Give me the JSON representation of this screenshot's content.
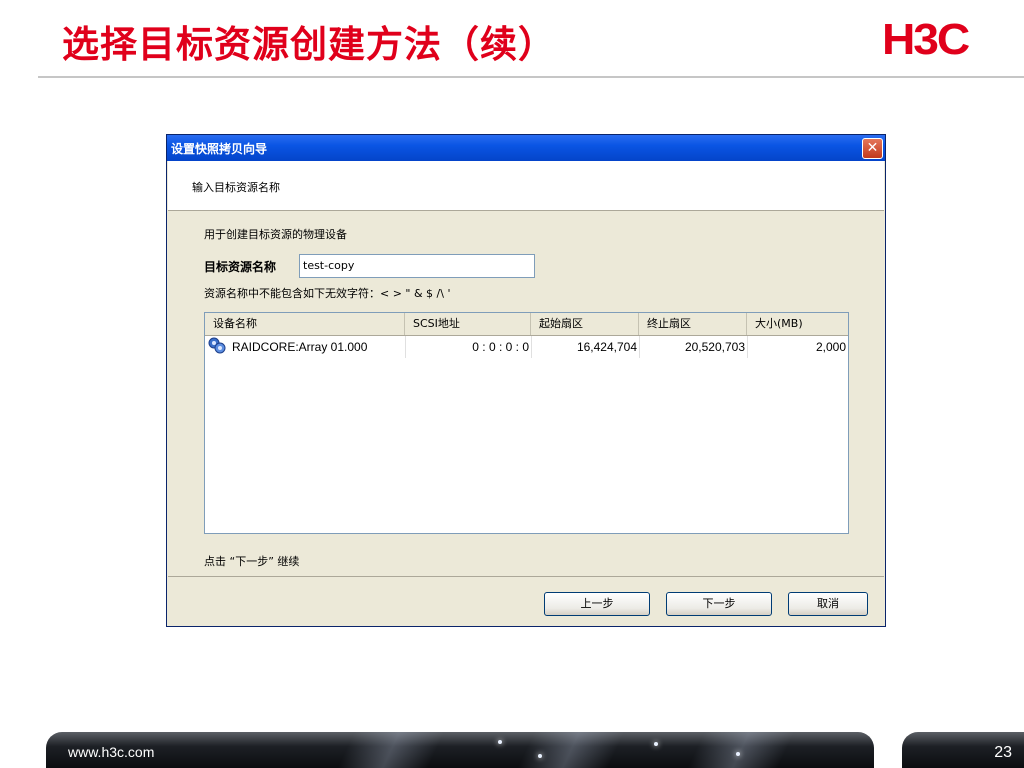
{
  "slide": {
    "title": "选择目标资源创建方法（续）",
    "logo": "H3C",
    "footer_url": "www.h3c.com",
    "page_number": "23"
  },
  "dialog": {
    "title": "设置快照拷贝向导",
    "close_glyph": "✕",
    "step_header": "输入目标资源名称",
    "purpose_label": "用于创建目标资源的物理设备",
    "name_label": "目标资源名称",
    "name_value": "test-copy",
    "invalid_chars_label": "资源名称中不能包含如下无效字符：< > \" & $ /\\ '",
    "hint": "点击 “下一步” 继续",
    "buttons": {
      "prev": "上一步",
      "next": "下一步",
      "cancel": "取消"
    }
  },
  "table": {
    "columns": [
      "设备名称",
      "SCSI地址",
      "起始扇区",
      "终止扇区",
      "大小(MB)"
    ],
    "rows": [
      {
        "icon": "raid-device-icon",
        "name": "RAIDCORE:Array 01.000",
        "scsi": "0 : 0 : 0 : 0",
        "start": "16,424,704",
        "end": "20,520,703",
        "size": "2,000"
      }
    ]
  },
  "colors": {
    "title_red": "#e0001b",
    "titlebar_blue": "#0a55e4",
    "dialog_bg": "#ece9d8"
  }
}
